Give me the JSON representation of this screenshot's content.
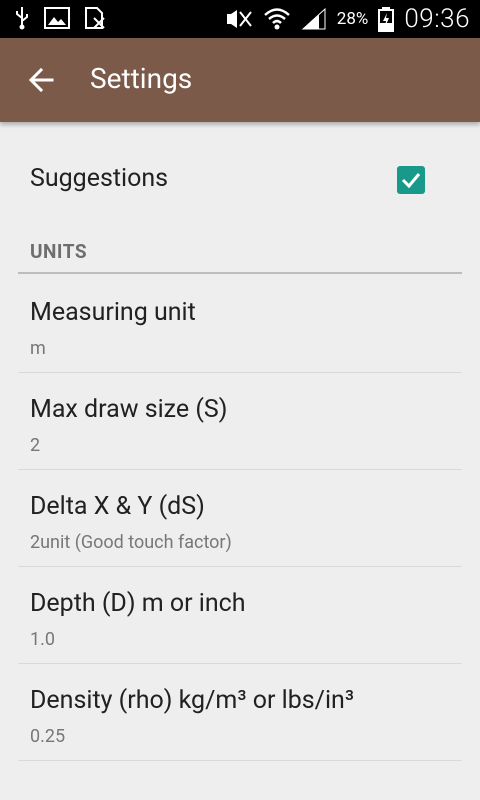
{
  "status_bar": {
    "battery_percent": "28%",
    "time": "09:36",
    "icons": [
      "usb-icon",
      "image-icon",
      "sim-icon",
      "mute-icon",
      "wifi-icon",
      "signal-icon",
      "battery-icon"
    ]
  },
  "appbar": {
    "title": "Settings"
  },
  "suggestions": {
    "label": "Suggestions",
    "checked": true
  },
  "section_units": {
    "title": "UNITS"
  },
  "items": [
    {
      "title": "Measuring unit",
      "value": "m"
    },
    {
      "title": "Max draw size (S)",
      "value": "2"
    },
    {
      "title": "Delta X & Y (dS)",
      "value": "2unit (Good touch factor)"
    },
    {
      "title": "Depth (D) m or inch",
      "value": "1.0"
    },
    {
      "title": "Density (rho) kg/m³ or lbs/in³",
      "value": "0.25"
    }
  ],
  "colors": {
    "appbar": "#7b5a49",
    "checkbox": "#19998a",
    "background": "#efeeee"
  }
}
